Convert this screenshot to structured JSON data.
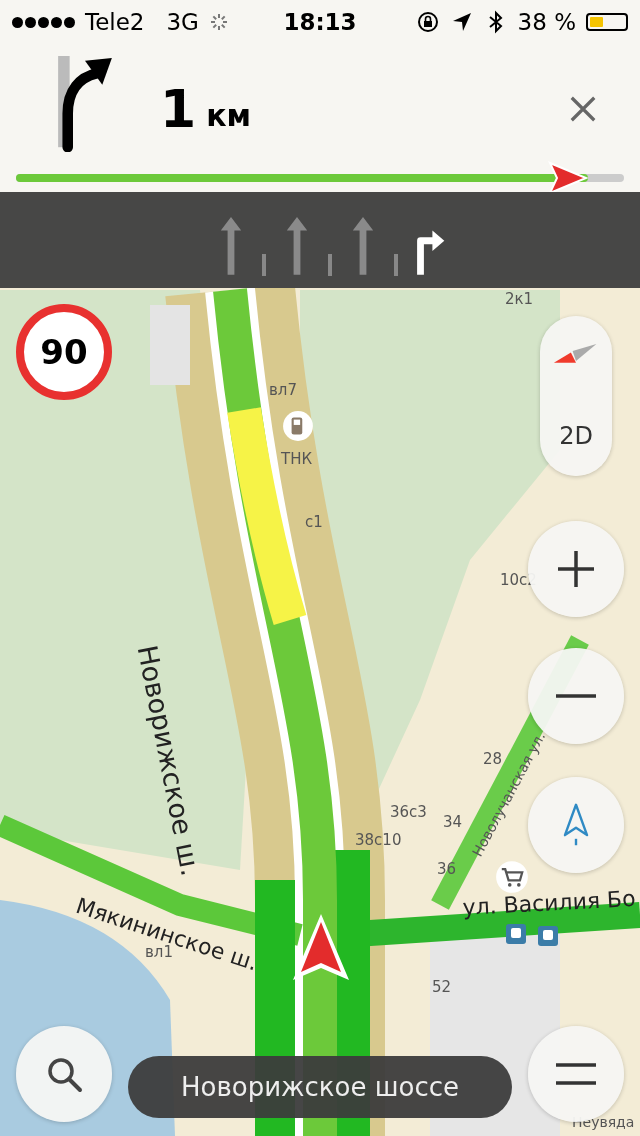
{
  "status_bar": {
    "carrier": "Tele2",
    "network": "3G",
    "time": "18:13",
    "battery_text": "38 %",
    "battery": {
      "level": 0.38
    }
  },
  "maneuver": {
    "distance": "1",
    "unit": "км"
  },
  "route_progress": {
    "level": 0.94
  },
  "lanes": [
    {
      "kind": "straight",
      "selected": false
    },
    {
      "kind": "straight",
      "selected": false
    },
    {
      "kind": "straight",
      "selected": false
    },
    {
      "kind": "right",
      "selected": true
    }
  ],
  "speed_limit": "90",
  "map_controls": {
    "view_mode": "2D"
  },
  "map_labels": [
    "вл7",
    "ТНК",
    "с1",
    "Новорижское ш.",
    "2к1",
    "10с2",
    "28",
    "36с3",
    "34",
    "38с10",
    "36",
    "Мякининское ш.",
    "вл1",
    "52",
    "ул. Василия Бо",
    "Новолучанская ул.",
    "Неувяда"
  ],
  "current_street": "Новорижское шоссе"
}
